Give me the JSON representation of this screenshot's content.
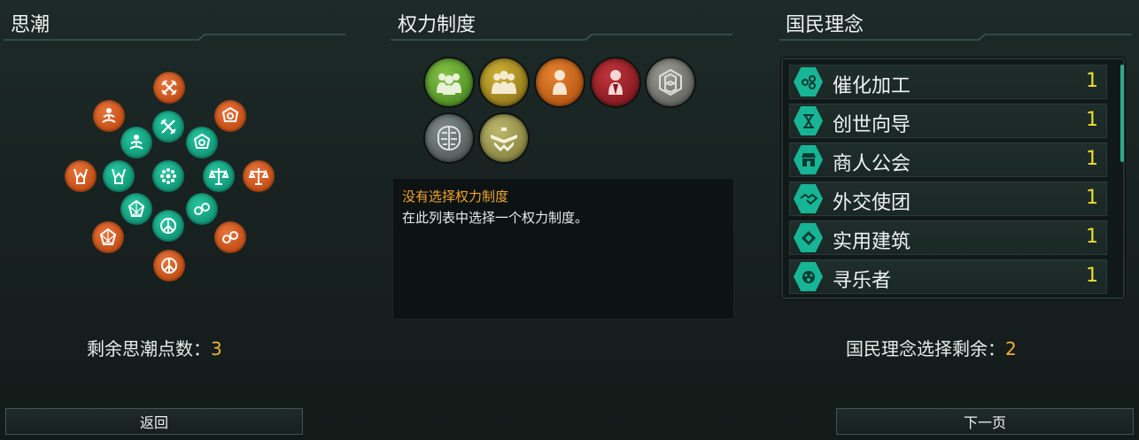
{
  "ethics_panel": {
    "title": "思潮",
    "remaining_label": "剩余思潮点数：",
    "remaining_value": "3"
  },
  "authority_panel": {
    "title": "权力制度",
    "authorities": [
      {
        "name": "民主制",
        "icon": "democratic-people-icon",
        "color": "#6fae3a"
      },
      {
        "name": "寡头制",
        "icon": "oligarchic-people-icon",
        "color": "#b59a22"
      },
      {
        "name": "独裁制",
        "icon": "dictatorial-person-icon",
        "color": "#d5701c"
      },
      {
        "name": "帝制",
        "icon": "imperial-person-icon",
        "color": "#a3262a"
      },
      {
        "name": "企业制",
        "icon": "corporate-hexagon-icon",
        "color": "#8a8a84"
      },
      {
        "name": "蜂巢思维",
        "icon": "hive-mind-brain-icon",
        "color": "#6f7877"
      },
      {
        "name": "机械智能",
        "icon": "machine-intelligence-icon",
        "color": "#a8a560"
      }
    ],
    "description_title": "没有选择权力制度",
    "description_text": "在此列表中选择一个权力制度。"
  },
  "civics_panel": {
    "title": "国民理念",
    "items": [
      {
        "label": "催化加工",
        "cost": "1",
        "icon": "catalytic-processing-icon"
      },
      {
        "label": "创世向导",
        "cost": "1",
        "icon": "genesis-guides-icon"
      },
      {
        "label": "商人公会",
        "cost": "1",
        "icon": "merchant-guilds-icon"
      },
      {
        "label": "外交使团",
        "cost": "1",
        "icon": "diplomatic-corps-icon"
      },
      {
        "label": "实用建筑",
        "cost": "1",
        "icon": "functional-architecture-icon"
      },
      {
        "label": "寻乐者",
        "cost": "1",
        "icon": "pleasure-seekers-icon"
      }
    ],
    "remaining_label": "国民理念选择剩余：",
    "remaining_value": "2"
  },
  "buttons": {
    "back": "返回",
    "next": "下一页"
  },
  "colors": {
    "ethic_orange": "#d85e22",
    "ethic_teal": "#18b08f",
    "accent_number": "#f0b13b",
    "civic_cost": "#eddd2e",
    "description_title": "#f0a52f"
  }
}
